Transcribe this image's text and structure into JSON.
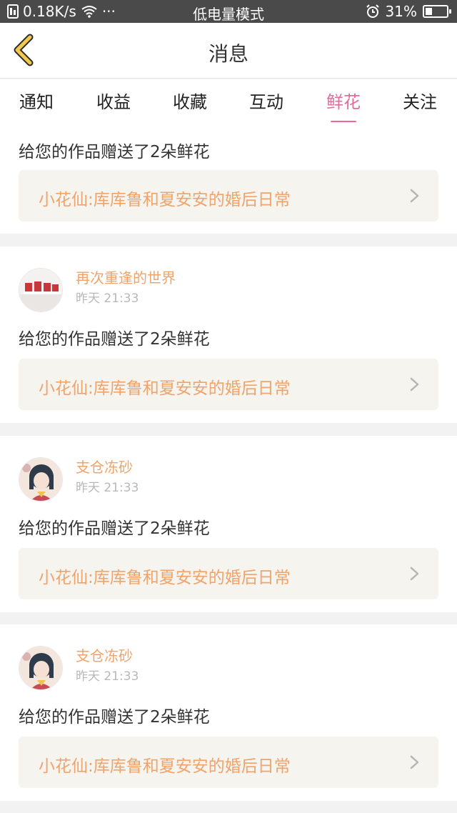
{
  "status_bar": {
    "net_speed": "0.18K/s",
    "dots": "···",
    "mode": "低电量模式",
    "battery": "31%",
    "battery_level": 0.31
  },
  "header": {
    "title": "消息"
  },
  "tabs": [
    {
      "label": "通知"
    },
    {
      "label": "收益"
    },
    {
      "label": "收藏"
    },
    {
      "label": "互动"
    },
    {
      "label": "鲜花",
      "active": true
    },
    {
      "label": "关注"
    }
  ],
  "messages": [
    {
      "text": "给您的作品赠送了2朵鲜花",
      "work": "小花仙:库库鲁和夏安安的婚后日常"
    },
    {
      "user": "再次重逢的世界",
      "time": "昨天 21:33",
      "text": "给您的作品赠送了2朵鲜花",
      "work": "小花仙:库库鲁和夏安安的婚后日常"
    },
    {
      "user": "支仓冻砂",
      "time": "昨天 21:33",
      "text": "给您的作品赠送了2朵鲜花",
      "work": "小花仙:库库鲁和夏安安的婚后日常"
    },
    {
      "user": "支仓冻砂",
      "time": "昨天 21:33",
      "text": "给您的作品赠送了2朵鲜花",
      "work": "小花仙:库库鲁和夏安安的婚后日常"
    }
  ],
  "colors": {
    "accent_pink": "#e56b9c",
    "username_orange": "#f0a36b",
    "back_arrow_yellow": "#f3c84b"
  }
}
